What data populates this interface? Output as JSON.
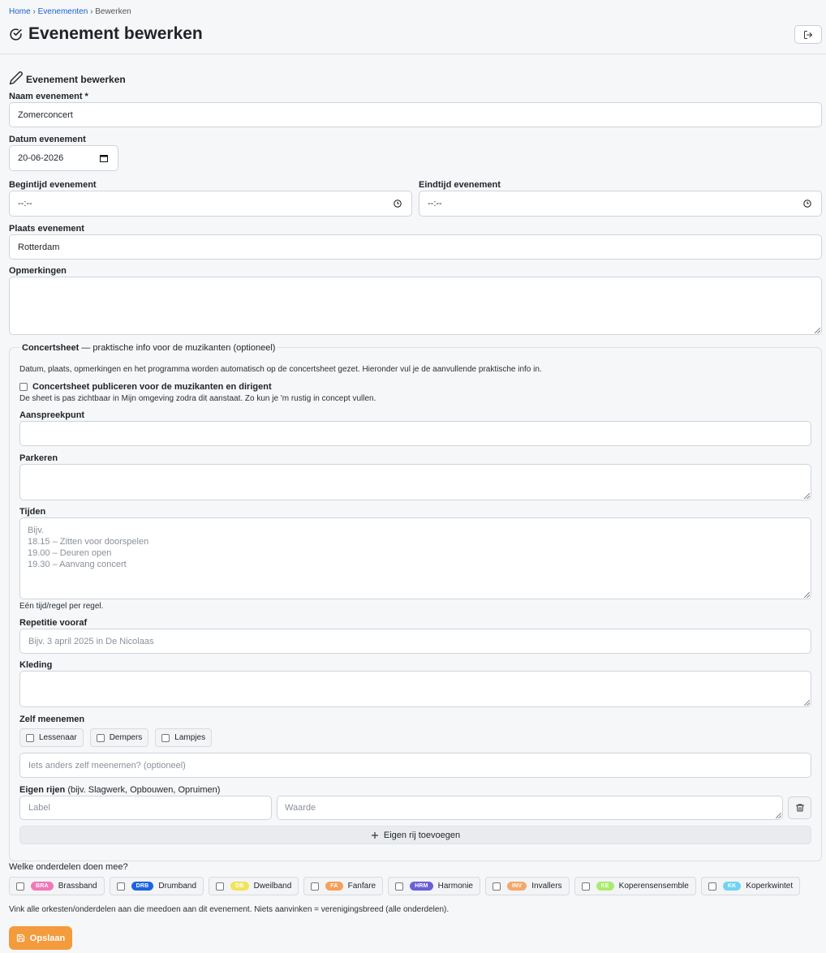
{
  "breadcrumb": {
    "home": "Home",
    "events": "Evenementen",
    "current": "Bewerken",
    "sep": "›"
  },
  "page": {
    "title": "Evenement bewerken"
  },
  "form": {
    "section_title": "Evenement bewerken",
    "name": {
      "label": "Naam evenement *",
      "value": "Zomerconcert"
    },
    "date": {
      "label": "Datum evenement",
      "value": "20-06-2026"
    },
    "start_time": {
      "label": "Begintijd evenement",
      "value": "--:--"
    },
    "end_time": {
      "label": "Eindtijd evenement",
      "value": "--:--"
    },
    "place": {
      "label": "Plaats evenement",
      "value": "Rotterdam"
    },
    "remarks": {
      "label": "Opmerkingen",
      "value": ""
    }
  },
  "concertsheet": {
    "legend_bold": "Concertsheet",
    "legend_rest": " — praktische info voor de muzikanten (optioneel)",
    "intro": "Datum, plaats, opmerkingen en het programma worden automatisch op de concertsheet gezet. Hieronder vul je de aanvullende praktische info in.",
    "publish_label": "Concertsheet publiceren voor de muzikanten en dirigent",
    "publish_help": "De sheet is pas zichtbaar in Mijn omgeving zodra dit aanstaat. Zo kun je 'm rustig in concept vullen.",
    "contact_label": "Aanspreekpunt",
    "parking_label": "Parkeren",
    "times_label": "Tijden",
    "times_placeholder": "Bijv.\n18.15 – Zitten voor doorspelen\n19.00 – Deuren open\n19.30 – Aanvang concert",
    "times_help": "Eén tijd/regel per regel.",
    "rehearsal_label": "Repetitie vooraf",
    "rehearsal_placeholder": "Bijv. 3 april 2025 in De Nicolaas",
    "clothing_label": "Kleding",
    "bring_label": "Zelf meenemen",
    "bring_items": [
      "Lessenaar",
      "Dempers",
      "Lampjes"
    ],
    "bring_other_placeholder": "Iets anders zelf meenemen? (optioneel)",
    "custom_rows_label": "Eigen rijen",
    "custom_rows_hint": "(bijv. Slagwerk, Opbouwen, Opruimen)",
    "custom_label_placeholder": "Label",
    "custom_value_placeholder": "Waarde",
    "add_row_label": "Eigen rij toevoegen"
  },
  "divisions": {
    "label": "Welke onderdelen doen mee?",
    "items": [
      {
        "code": "BRA",
        "name": "Brassband",
        "color": "#f277b8"
      },
      {
        "code": "DRB",
        "name": "Drumband",
        "color": "#1c63e0"
      },
      {
        "code": "DB",
        "name": "Dweilband",
        "color": "#f2e35a"
      },
      {
        "code": "FA",
        "name": "Fanfare",
        "color": "#f5a05a"
      },
      {
        "code": "HRM",
        "name": "Harmonie",
        "color": "#6a5fd8"
      },
      {
        "code": "INV",
        "name": "Invallers",
        "color": "#f4a86a"
      },
      {
        "code": "KE",
        "name": "Koperensensemble",
        "color": "#a9ec6d"
      },
      {
        "code": "KK",
        "name": "Koperkwintet",
        "color": "#6fd3f1"
      }
    ],
    "help": "Vink alle orkesten/onderdelen aan die meedoen aan dit evenement. Niets aanvinken = verenigingsbreed (alle onderdelen)."
  },
  "actions": {
    "save_label": "Opslaan"
  },
  "colors": {
    "accent": "#f39b3d",
    "link": "#1a5fd0"
  }
}
